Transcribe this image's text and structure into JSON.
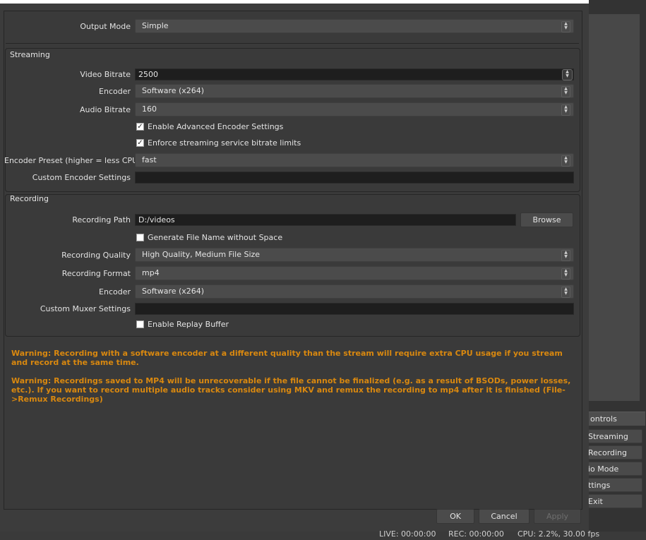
{
  "output_mode": {
    "label": "Output Mode",
    "value": "Simple"
  },
  "streaming": {
    "title": "Streaming",
    "video_bitrate": {
      "label": "Video Bitrate",
      "value": "2500"
    },
    "encoder": {
      "label": "Encoder",
      "value": "Software (x264)"
    },
    "audio_bitrate": {
      "label": "Audio Bitrate",
      "value": "160"
    },
    "advanced": {
      "label": "Enable Advanced Encoder Settings",
      "checked": true
    },
    "enforce": {
      "label": "Enforce streaming service bitrate limits",
      "checked": true
    },
    "preset": {
      "label": "Encoder Preset (higher = less CPU)",
      "value": "fast"
    },
    "custom": {
      "label": "Custom Encoder Settings",
      "value": ""
    }
  },
  "recording": {
    "title": "Recording",
    "path": {
      "label": "Recording Path",
      "value": "D:/videos",
      "browse": "Browse"
    },
    "no_space": {
      "label": "Generate File Name without Space",
      "checked": false
    },
    "quality": {
      "label": "Recording Quality",
      "value": "High Quality, Medium File Size"
    },
    "format": {
      "label": "Recording Format",
      "value": "mp4"
    },
    "encoder": {
      "label": "Encoder",
      "value": "Software (x264)"
    },
    "muxer": {
      "label": "Custom Muxer Settings",
      "value": ""
    },
    "replay": {
      "label": "Enable Replay Buffer",
      "checked": false
    }
  },
  "warnings": [
    "Warning: Recording with a software encoder at a different quality than the stream will require extra CPU usage if you stream and record at the same time.",
    "Warning: Recordings saved to MP4 will be unrecoverable if the file cannot be finalized (e.g. as a result of BSODs, power losses, etc.). If you want to record multiple audio tracks consider using MKV and remux the recording to mp4 after it is finished (File->Remux Recordings)"
  ],
  "buttons": {
    "ok": "OK",
    "cancel": "Cancel",
    "apply": "Apply"
  },
  "controls_panel": {
    "header": "ontrols",
    "items": [
      "Streaming",
      "Recording",
      "io Mode",
      "ttings",
      "Exit"
    ]
  },
  "status": {
    "live": "LIVE: 00:00:00",
    "rec": "REC: 00:00:00",
    "cpu": "CPU: 2.2%, 30.00 fps"
  },
  "colors": {
    "warning": "#d9880f",
    "background": "#3a3a3a"
  }
}
